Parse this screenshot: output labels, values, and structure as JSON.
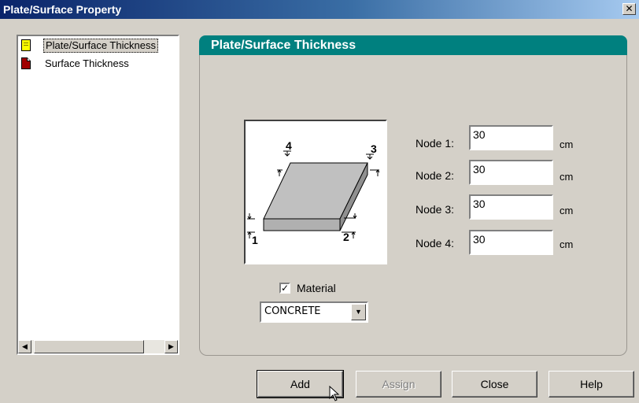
{
  "window": {
    "title": "Plate/Surface Property",
    "close_glyph": "✕"
  },
  "tree": {
    "items": [
      {
        "label": "Plate/Surface Thickness",
        "icon": "page-yellow-icon",
        "selected": true
      },
      {
        "label": "Surface Thickness",
        "icon": "page-red-icon",
        "selected": false
      }
    ]
  },
  "panel": {
    "title": "Plate/Surface Thickness"
  },
  "diagram": {
    "labels": [
      "1",
      "2",
      "3",
      "4"
    ]
  },
  "nodes": [
    {
      "label": "Node 1:",
      "value": "30",
      "unit": "cm"
    },
    {
      "label": "Node 2:",
      "value": "30",
      "unit": "cm"
    },
    {
      "label": "Node 3:",
      "value": "30",
      "unit": "cm"
    },
    {
      "label": "Node 4:",
      "value": "30",
      "unit": "cm"
    }
  ],
  "material": {
    "checkbox_label": "Material",
    "checked": true,
    "check_glyph": "✓",
    "selected": "CONCRETE"
  },
  "buttons": {
    "add": "Add",
    "assign": "Assign",
    "close": "Close",
    "help": "Help"
  },
  "colors": {
    "titlebar": "#0a246a",
    "panel_header": "#00807f",
    "face": "#d4d0c8"
  }
}
